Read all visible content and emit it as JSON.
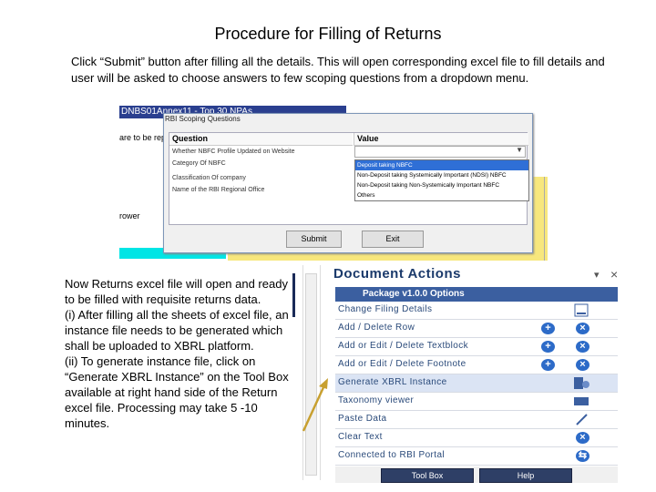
{
  "slide": {
    "title": "Procedure for Filling of Returns",
    "intro": "Click “Submit” button after filling all the details. This will open corresponding excel file to fill details and user will be asked to choose answers to few scoping questions from a dropdown menu.",
    "returns_text": "Now Returns excel file will open and ready to be filled with requisite returns data.\n(i) After filling all the sheets of excel file, an instance file needs to be generated which shall be uploaded to XBRL platform.\n(ii) To generate instance file, click on “Generate XBRL Instance” on the Tool Box available at right hand side of the Return excel file. Processing may take 5 -10 minutes."
  },
  "excel": {
    "sheet_title": "DNBS01Annex11 - Top 30 NPAs",
    "row_text": "are to be rep",
    "borrower": "rower"
  },
  "dialog": {
    "title": "RBI Scoping Questions",
    "col_question": "Question",
    "col_value": "Value",
    "questions": [
      "Whether NBFC Profile Updated on Website",
      "Category Of NBFC",
      "Classification Of company",
      "Name of the RBI Regional Office"
    ],
    "dropdown_options": [
      "Deposit taking NBFC",
      "Non-Deposit taking Systemically Important (NDSI) NBFC",
      "Non-Deposit taking Non-Systemically Important NBFC",
      "Others"
    ],
    "selected_value": "Deposit taking NBFC",
    "submit_label": "Submit",
    "exit_label": "Exit"
  },
  "pane": {
    "title": "Document Actions",
    "package_label": "Package v1.0.0 Options",
    "actions": [
      {
        "label": "Change Filing Details",
        "icon": "filing-icon"
      },
      {
        "label": "Add / Delete Row",
        "icon": "add-delete-icons"
      },
      {
        "label": "Add or Edit / Delete Textblock",
        "icon": "add-delete-icons"
      },
      {
        "label": "Add or Edit / Delete Footnote",
        "icon": "add-delete-icons"
      },
      {
        "label": "Generate XBRL Instance",
        "icon": "generate-icon"
      },
      {
        "label": "Taxonomy viewer",
        "icon": "xbrl-icon"
      },
      {
        "label": "Paste Data",
        "icon": "paste-icon"
      },
      {
        "label": "Clear Text",
        "icon": "clear-icon"
      },
      {
        "label": "Connected to RBI Portal",
        "icon": "connect-icon"
      }
    ],
    "toolbox_label": "Tool Box",
    "help_label": "Help"
  },
  "colors": {
    "accent": "#3b5fa0",
    "arrow": "#c8a030",
    "excel_yellow": "#f7e77d",
    "excel_cyan": "#00e5e5",
    "selection_blue": "#2f6fd6"
  }
}
